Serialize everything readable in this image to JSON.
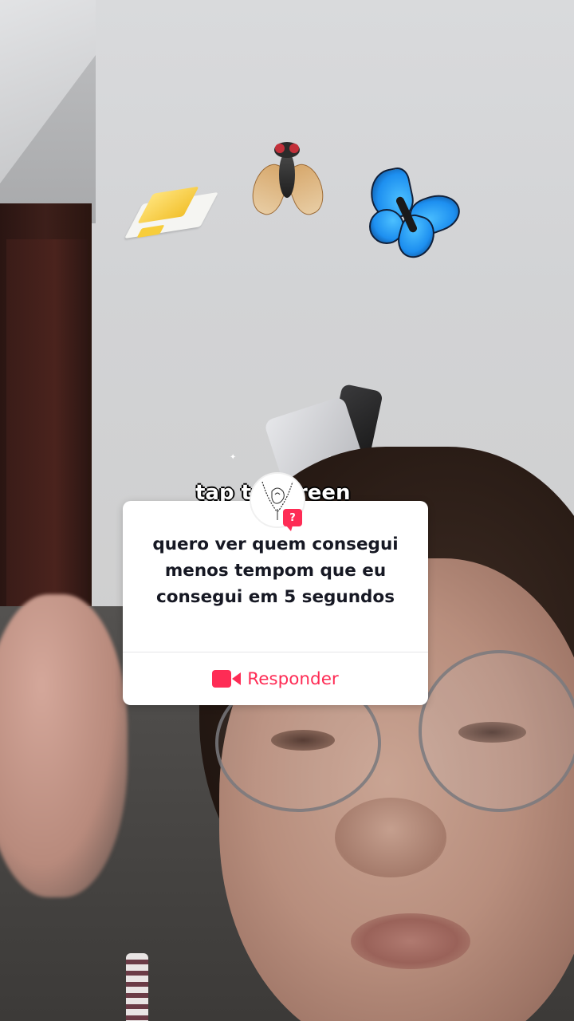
{
  "overlay_caption": "tap to screen",
  "stickers": [
    "butter-emoji",
    "fly-emoji",
    "butterfly-emoji"
  ],
  "question_card": {
    "question": "quero ver quem consegui menos tempom que eu consegui em 5 segundos",
    "reply_label": "Responder",
    "badge": "?"
  },
  "colors": {
    "accent": "#fe2c55",
    "card_text": "#161823",
    "card_background": "#ffffff"
  }
}
